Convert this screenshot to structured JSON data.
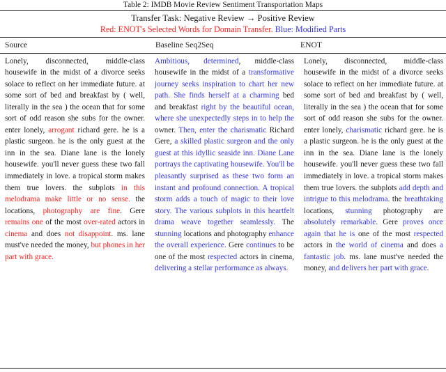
{
  "caption": "Table 2: IMDB Movie Review Sentiment Transportation Maps",
  "banner": {
    "transfer_task": "Transfer Task: Negative Review → Positive Review",
    "legend_red": "Red: ENOT's Selected Words for Domain Transfer.",
    "legend_blue": "Blue: Modified Parts",
    "color_red": "#ff2020",
    "color_blue": "#3333ee"
  },
  "columns": {
    "source": "Source",
    "baseline": "Baseline Seq2Seq",
    "enot": "ENOT"
  },
  "source_text": [
    {
      "t": "Lonely, disconnected, middle-class housewife in the midst of a divorce seeks solace to reflect on her immediate future.  at some sort of bed and breakfast by ( well, literally in the sea ) the ocean that for some sort of odd reason she subs for the owner.  enter lonely, ",
      "c": "black"
    },
    {
      "t": "arrogant",
      "c": "red"
    },
    {
      "t": " richard gere. he is a plastic surgeon. he is the only guest at the inn in the sea. Diane lane is the lonely housewife.  you'll never guess these two fall immediately in love. a tropical storm makes them true lovers.  the subplots ",
      "c": "black"
    },
    {
      "t": "in this melodrama make little or no sense.",
      "c": "red"
    },
    {
      "t": " the locations, ",
      "c": "black"
    },
    {
      "t": "photography are fine",
      "c": "red"
    },
    {
      "t": ". Gere ",
      "c": "black"
    },
    {
      "t": "remains one",
      "c": "red"
    },
    {
      "t": " of the most ",
      "c": "black"
    },
    {
      "t": "over-rated",
      "c": "red"
    },
    {
      "t": " actors in ",
      "c": "black"
    },
    {
      "t": "cinema",
      "c": "red"
    },
    {
      "t": " and does ",
      "c": "black"
    },
    {
      "t": "not disappoint",
      "c": "red"
    },
    {
      "t": ". ms.  lane must've needed the money, ",
      "c": "black"
    },
    {
      "t": "but phones in her part with grace.",
      "c": "red"
    }
  ],
  "baseline_text": [
    {
      "t": "Ambitious, determined",
      "c": "blue"
    },
    {
      "t": ", middle-class housewife in the midst of a ",
      "c": "black"
    },
    {
      "t": "transformative journey seeks inspiration to chart her new path. She finds herself at a charming",
      "c": "blue"
    },
    {
      "t": " bed and breakfast ",
      "c": "black"
    },
    {
      "t": "right by the beautiful ocean, where she unexpectedly steps in to help the",
      "c": "blue"
    },
    {
      "t": " owner.  ",
      "c": "black"
    },
    {
      "t": "Then, enter the charismatic",
      "c": "blue"
    },
    {
      "t": " Richard Gere, ",
      "c": "black"
    },
    {
      "t": "a skilled plastic surgeon and the only guest at this idyllic seaside inn. Diane Lane portrays the captivating housewife.  You'll be pleasantly surprised as these two form an instant and profound connection.  A tropical storm adds a touch of magic to their love story. The various subplots in this heartfelt drama weave together seamlessly.",
      "c": "blue"
    },
    {
      "t": "  The ",
      "c": "black"
    },
    {
      "t": "stunning",
      "c": "blue"
    },
    {
      "t": " locations and photography ",
      "c": "black"
    },
    {
      "t": "enhance the overall experience.",
      "c": "blue"
    },
    {
      "t": " Gere ",
      "c": "black"
    },
    {
      "t": "continues",
      "c": "blue"
    },
    {
      "t": " to be one of the most ",
      "c": "black"
    },
    {
      "t": "respected",
      "c": "blue"
    },
    {
      "t": " actors in cinema, ",
      "c": "black"
    },
    {
      "t": "delivering a stellar performance as always.",
      "c": "blue"
    }
  ],
  "enot_text": [
    {
      "t": "Lonely, disconnected, middle-class housewife in the midst of a divorce seeks solace to reflect on her immediate future.  at some sort of bed and breakfast by ( well, literally in the sea ) the ocean that for some sort of odd reason she subs for the owner. enter lonely, ",
      "c": "black"
    },
    {
      "t": "charismatic",
      "c": "blue"
    },
    {
      "t": " richard gere. he is a plastic surgeon.  he is the only guest at the inn in the sea. Diane lane is the lonely housewife.  you'll never guess these two fall immediately in love. a tropical storm makes them true lovers. the subplots ",
      "c": "black"
    },
    {
      "t": "add depth and intrigue to this melodrama",
      "c": "blue"
    },
    {
      "t": ".  the ",
      "c": "black"
    },
    {
      "t": "breathtaking",
      "c": "blue"
    },
    {
      "t": " locations, ",
      "c": "black"
    },
    {
      "t": "stunning",
      "c": "blue"
    },
    {
      "t": " photography are ",
      "c": "black"
    },
    {
      "t": "absolutely remarkable",
      "c": "blue"
    },
    {
      "t": ". Gere ",
      "c": "black"
    },
    {
      "t": "proves once again that he is",
      "c": "blue"
    },
    {
      "t": " one of the most ",
      "c": "black"
    },
    {
      "t": "respected",
      "c": "blue"
    },
    {
      "t": " actors in ",
      "c": "black"
    },
    {
      "t": "the world of cinema",
      "c": "blue"
    },
    {
      "t": " and does ",
      "c": "black"
    },
    {
      "t": "a fantastic job",
      "c": "blue"
    },
    {
      "t": ".  ms.  lane must've needed the money, ",
      "c": "black"
    },
    {
      "t": "and delivers her part with grace",
      "c": "blue"
    },
    {
      "t": ".",
      "c": "black"
    }
  ]
}
